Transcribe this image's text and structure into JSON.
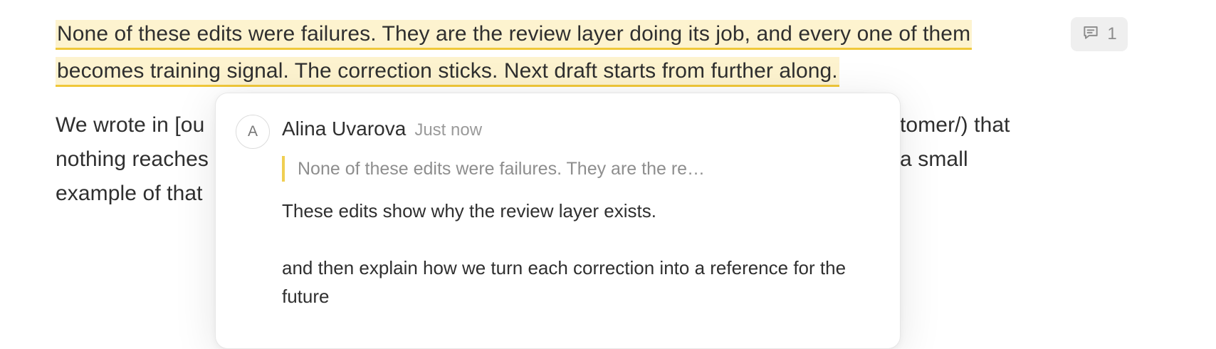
{
  "document": {
    "highlighted_paragraph": {
      "lines": [
        "None of these edits were failures. They are the review layer doing its job, and every one of them",
        "becomes training signal. The correction sticks. Next draft starts from further along."
      ]
    },
    "body_paragraph": {
      "lines": [
        "We wrote in [ou",
        "nothing reaches",
        "example of that"
      ],
      "right_fragments": [
        "tomer/) that",
        "a small"
      ]
    }
  },
  "comment_badge": {
    "icon": "speech-bubble-icon",
    "count": "1"
  },
  "comment_popover": {
    "avatar_initial": "A",
    "author": "Alina Uvarova",
    "timestamp": "Just now",
    "quoted_excerpt": "None of these edits were failures. They are the re…",
    "body_paragraphs": [
      "These edits show why the review layer exists.",
      "and then explain how we turn each correction into a reference for the future"
    ]
  },
  "colors": {
    "highlight_bg": "#fdf3cf",
    "highlight_underline": "#f0c83a",
    "quote_bar": "#f0cf52",
    "text": "#2f2f2f",
    "muted": "#9a9a9a"
  }
}
